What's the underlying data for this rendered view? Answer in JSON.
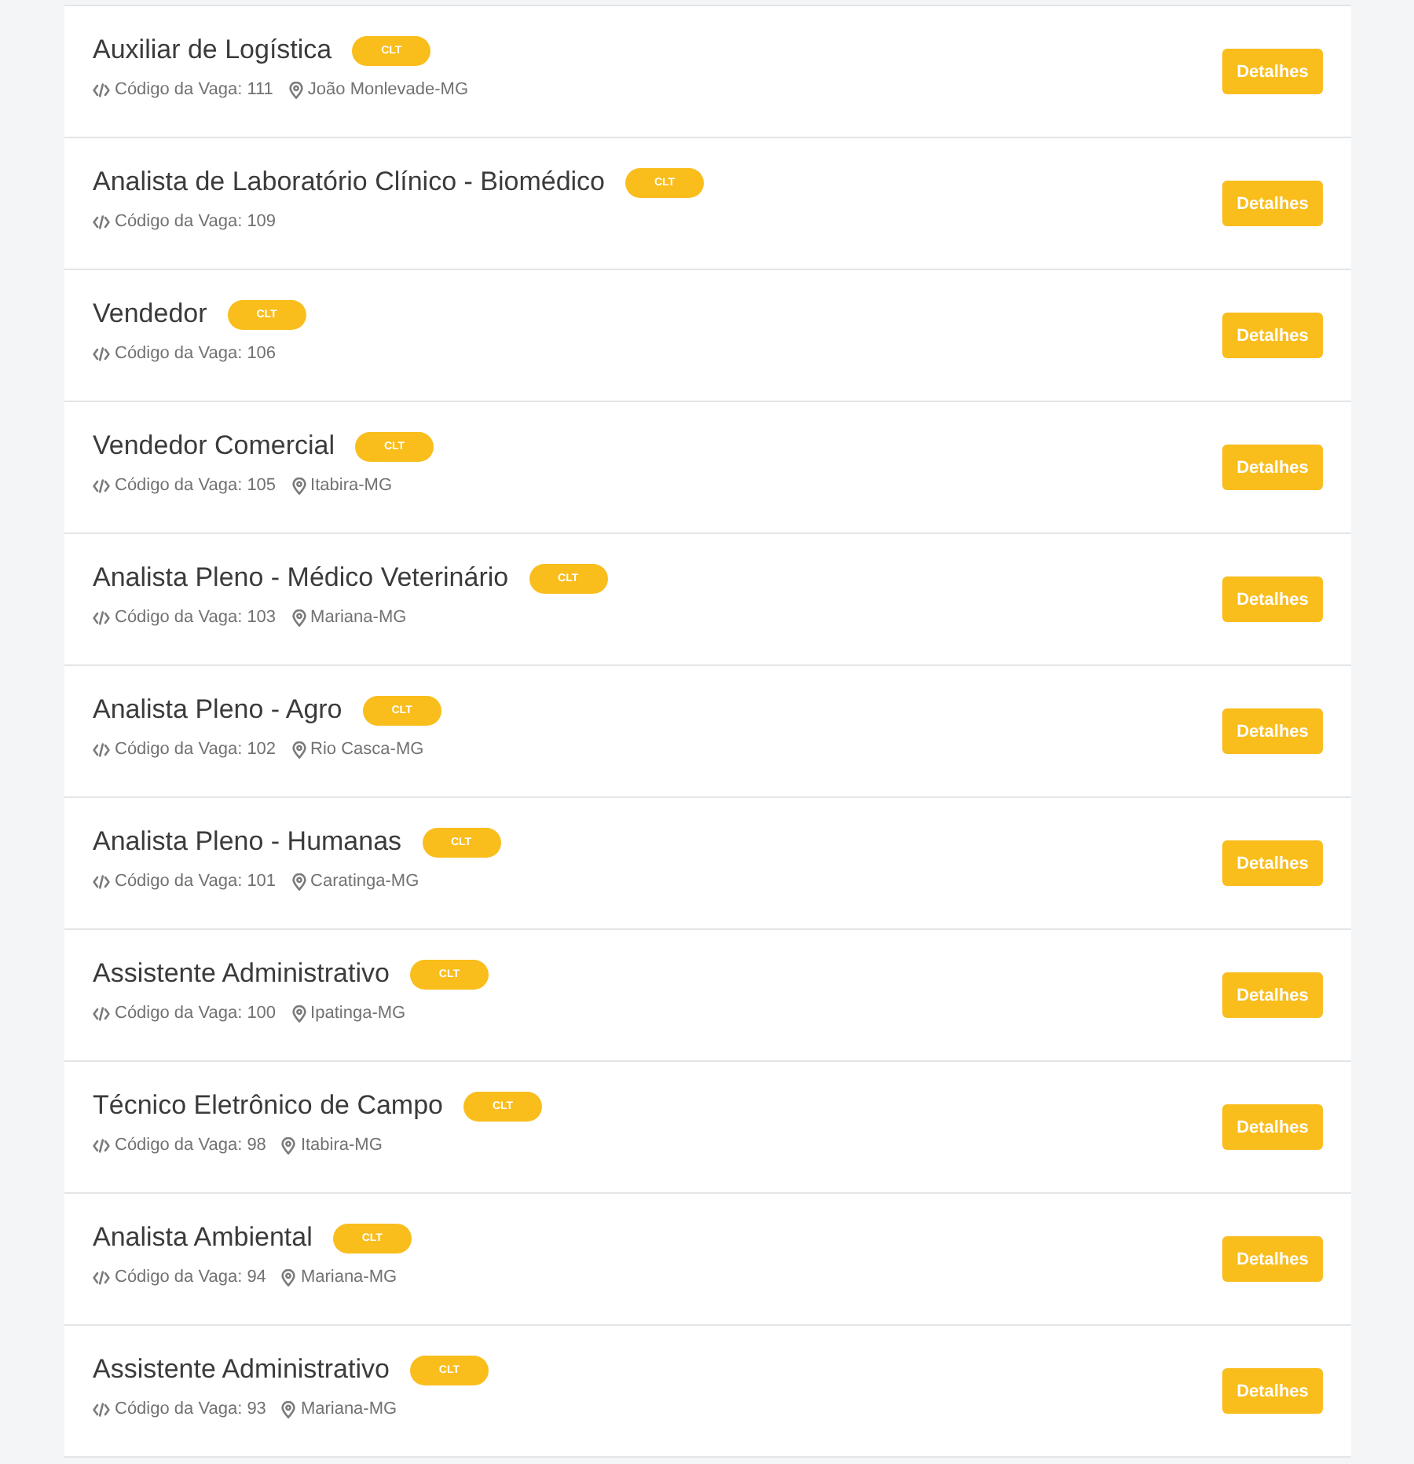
{
  "jobs": [
    {
      "title": "Auxiliar de Logística",
      "badge": "CLT",
      "code": "Código da Vaga: 111",
      "location": "João Monlevade-MG",
      "button": "Detalhes"
    },
    {
      "title": "Analista de Laboratório Clínico - Biomédico",
      "badge": "CLT",
      "code": "Código da Vaga: 109",
      "button": "Detalhes"
    },
    {
      "title": "Vendedor",
      "badge": "CLT",
      "code": "Código da Vaga: 106",
      "button": "Detalhes"
    },
    {
      "title": "Vendedor Comercial",
      "badge": "CLT",
      "code": "Código da Vaga: 105",
      "location": "Itabira-MG",
      "button": "Detalhes"
    },
    {
      "title": "Analista Pleno - Médico Veterinário",
      "badge": "CLT",
      "code": "Código da Vaga: 103",
      "location": "Mariana-MG",
      "button": "Detalhes"
    },
    {
      "title": "Analista Pleno - Agro",
      "badge": "CLT",
      "code": "Código da Vaga: 102",
      "location": "Rio Casca-MG",
      "button": "Detalhes"
    },
    {
      "title": "Analista Pleno - Humanas",
      "badge": "CLT",
      "code": "Código da Vaga: 101",
      "location": "Caratinga-MG",
      "button": "Detalhes"
    },
    {
      "title": "Assistente Administrativo",
      "badge": "CLT",
      "code": "Código da Vaga: 100",
      "location": "Ipatinga-MG",
      "button": "Detalhes"
    },
    {
      "title": "Técnico Eletrônico de Campo",
      "badge": "CLT",
      "code": "Código da Vaga: 98",
      "location": "Itabira-MG",
      "button": "Detalhes"
    },
    {
      "title": "Analista Ambiental",
      "badge": "CLT",
      "code": "Código da Vaga: 94",
      "location": "Mariana-MG",
      "button": "Detalhes"
    },
    {
      "title": "Assistente Administrativo",
      "badge": "CLT",
      "code": "Código da Vaga: 93",
      "location": "Mariana-MG",
      "button": "Detalhes"
    }
  ]
}
